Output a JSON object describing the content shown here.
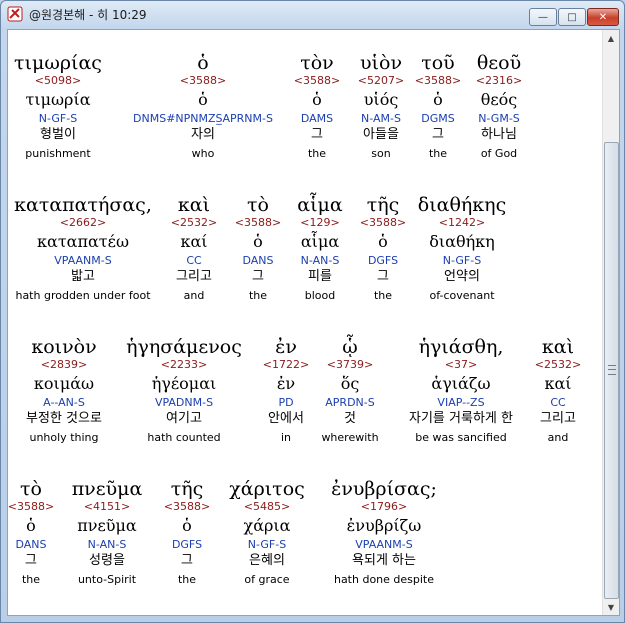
{
  "window": {
    "title": "@원경본해 - 히 10:29",
    "min_symbol": "—",
    "max_symbol": "□",
    "close_symbol": "✕"
  },
  "rows": [
    {
      "words": [
        {
          "greek": "τιμωρίας",
          "strong": "<5098>",
          "lemma": "τιμωρία",
          "parse": "N-GF-S",
          "korean": "형벌이",
          "english": "punishment"
        },
        {
          "greek": "ὁ",
          "strong": "<3588>",
          "lemma": "ὁ",
          "parse": "DNMS#NPNMZS̲APRNM-S",
          "korean": "자의",
          "english": "who"
        },
        {
          "greek": "τὸν",
          "strong": "<3588>",
          "lemma": "ὁ",
          "parse": "DAMS",
          "korean": "그",
          "english": "the"
        },
        {
          "greek": "υἱὸν",
          "strong": "<5207>",
          "lemma": "υἱός",
          "parse": "N-AM-S",
          "korean": "아들을",
          "english": "son"
        },
        {
          "greek": "τοῦ",
          "strong": "<3588>",
          "lemma": "ὁ",
          "parse": "DGMS",
          "korean": "그",
          "english": "the"
        },
        {
          "greek": "θεοῦ",
          "strong": "<2316>",
          "lemma": "θεός",
          "parse": "N-GM-S",
          "korean": "하나님",
          "english": "of God"
        }
      ]
    },
    {
      "words": [
        {
          "greek": "καταπατήσας,",
          "strong": "<2662>",
          "lemma": "καταπατέω",
          "parse": "VPAANM-S",
          "korean": "밟고",
          "english": "hath grodden under foot"
        },
        {
          "greek": "καὶ",
          "strong": "<2532>",
          "lemma": "καί",
          "parse": "CC",
          "korean": "그리고",
          "english": "and"
        },
        {
          "greek": "τὸ",
          "strong": "<3588>",
          "lemma": "ὁ",
          "parse": "DANS",
          "korean": "그",
          "english": "the"
        },
        {
          "greek": "αἷμα",
          "strong": "<129>",
          "lemma": "αἷμα",
          "parse": "N-AN-S",
          "korean": "피를",
          "english": "blood"
        },
        {
          "greek": "τῆς",
          "strong": "<3588>",
          "lemma": "ὁ",
          "parse": "DGFS",
          "korean": "그",
          "english": "the"
        },
        {
          "greek": "διαθήκης",
          "strong": "<1242>",
          "lemma": "διαθήκη",
          "parse": "N-GF-S",
          "korean": "언약의",
          "english": "of-covenant"
        }
      ]
    },
    {
      "words": [
        {
          "greek": "κοινὸν",
          "strong": "<2839>",
          "lemma": "κοιμάω",
          "parse": "A--AN-S",
          "korean": "부정한 것으로",
          "english": "unholy thing"
        },
        {
          "greek": "ἡγησάμενος",
          "strong": "<2233>",
          "lemma": "ἡγέομαι",
          "parse": "VPADNM-S",
          "korean": "여기고",
          "english": "hath counted"
        },
        {
          "greek": "ἐν",
          "strong": "<1722>",
          "lemma": "ἐν",
          "parse": "PD",
          "korean": "안에서",
          "english": "in"
        },
        {
          "greek": "ᾧ",
          "strong": "<3739>",
          "lemma": "ὅς",
          "parse": "APRDN-S",
          "korean": "것",
          "english": "wherewith"
        },
        {
          "greek": "ἡγιάσθη,",
          "strong": "<37>",
          "lemma": "ἁγιάζω",
          "parse": "VIAP--ZS",
          "korean": "자기를 거룩하게 한",
          "english": "be was sancified"
        },
        {
          "greek": "καὶ",
          "strong": "<2532>",
          "lemma": "καί",
          "parse": "CC",
          "korean": "그리고",
          "english": "and"
        }
      ]
    },
    {
      "words": [
        {
          "greek": "τὸ",
          "strong": "<3588>",
          "lemma": "ὁ",
          "parse": "DANS",
          "korean": "그",
          "english": "the"
        },
        {
          "greek": "πνεῦμα",
          "strong": "<4151>",
          "lemma": "πνεῦμα",
          "parse": "N-AN-S",
          "korean": "성령을",
          "english": "unto-Spirit"
        },
        {
          "greek": "τῆς",
          "strong": "<3588>",
          "lemma": "ὁ",
          "parse": "DGFS",
          "korean": "그",
          "english": "the"
        },
        {
          "greek": "χάριτος",
          "strong": "<5485>",
          "lemma": "χάρια",
          "parse": "N-GF-S",
          "korean": "은혜의",
          "english": "of grace"
        },
        {
          "greek": "ἐνυβρίσας;",
          "strong": "<1796>",
          "lemma": "ἐνυβρίζω",
          "parse": "VPAANM-S",
          "korean": "욕되게 하는",
          "english": "hath done despite"
        }
      ]
    }
  ]
}
